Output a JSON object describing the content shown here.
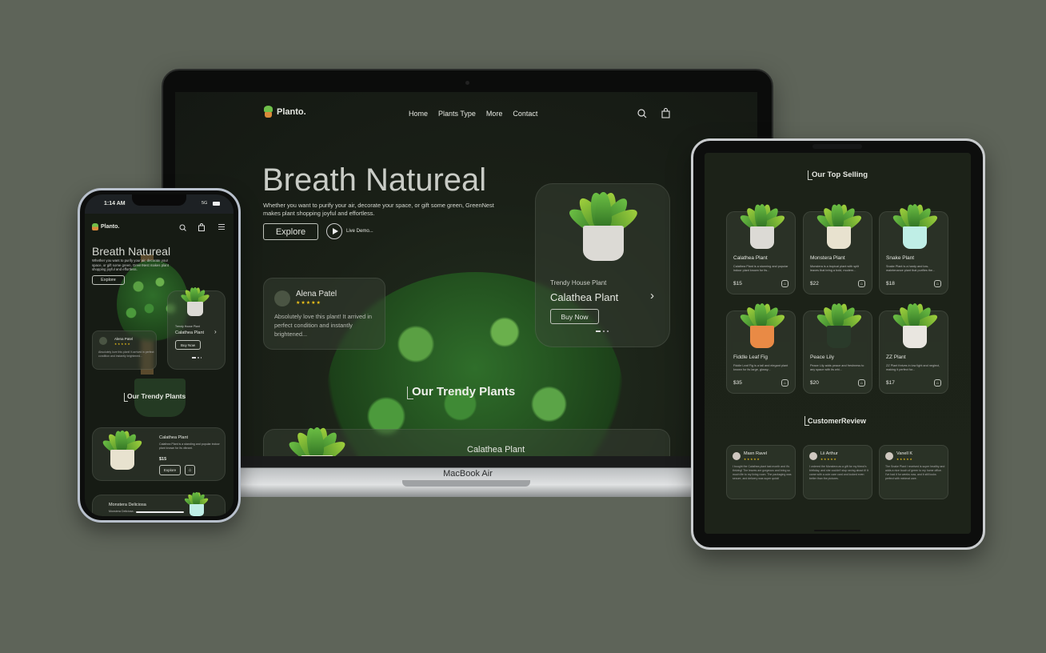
{
  "laptop": {
    "brand": "Planto.",
    "nav": [
      "Home",
      "Plants Type",
      "More",
      "Contact"
    ],
    "hero_title": "Breath Natureal",
    "hero_text": "Whether you want to purify your air, decorate your space, or gift some green, GreenNest makes plant shopping joyful and effortless.",
    "explore": "Explore",
    "live_demo": "Live Demo...",
    "review": {
      "name": "Alena Patel",
      "stars": "★★★★★",
      "text": "Absolutely love this plant! It arrived in perfect condition and instantly brightened..."
    },
    "product": {
      "subtitle": "Trendy House Plant",
      "name": "Calathea Plant",
      "button": "Buy Now",
      "chevron": "›"
    },
    "section_title": "Our Trendy Plants",
    "bottom_card_name": "Calathea Plant",
    "device_label": "MacBook Air"
  },
  "tablet": {
    "top_selling_title": "Our Top Selling",
    "products": [
      {
        "name": "Calathea Plant",
        "desc": "Calathea Plant is a stunning and popular indoor plant known for its...",
        "price": "$15"
      },
      {
        "name": "Monstera Plant",
        "desc": "Monstera is a tropical plant with split leaves that bring a bold, modern...",
        "price": "$22"
      },
      {
        "name": "Snake Plant",
        "desc": "Snake Plant is a hardy and low-maintenance plant that purifies the...",
        "price": "$18"
      },
      {
        "name": "Fiddle Leaf Fig",
        "desc": "Fiddle Leaf Fig is a tall and elegant plant known for its large, glossy...",
        "price": "$35"
      },
      {
        "name": "Peace Lily",
        "desc": "Peace Lily adds peace and freshness to any space with its whi...",
        "price": "$20"
      },
      {
        "name": "ZZ Plant",
        "desc": "ZZ Plant thrives in low light and neglect, making it perfect for...",
        "price": "$17"
      }
    ],
    "review_title": "CustomerReview",
    "reviews": [
      {
        "name": "Maxn Ravel",
        "stars": "★★★★★",
        "text": "I bought the Calathea plant last month and it's thriving! The leaves are gorgeous and bring so much life to my living room. The packaging was secure, and delivery was super quick!"
      },
      {
        "name": "Lii Arthur",
        "stars": "★★★★★",
        "text": "I ordered the Monstera as a gift for my friend's birthday, and she couldn't stop raving about it! It came with a cute care card and looked even better than the pictures."
      },
      {
        "name": "Vanell K",
        "stars": "★★★★★",
        "text": "The Snake Plant I received is super healthy and adds a nice touch of green to my home office. I've had it for weeks now, and it still looks perfect with minimal care."
      }
    ]
  },
  "phone": {
    "time": "1:14 AM",
    "network": "5G",
    "brand": "Planto.",
    "hero_title": "Breath Natureal",
    "hero_text": "Whether you want to purify your air, decorate your space, or gift some green, GreenNest makes plant shopping joyful and effortless.",
    "explore": "Explore",
    "review": {
      "name": "Alena Patel",
      "stars": "★★★★★",
      "text": "Absolutely love this plant! It arrived in perfect condition and instantly brightened..."
    },
    "product": {
      "subtitle": "Trendy House Plant",
      "name": "Calathea Plant",
      "button": "Buy Now",
      "chevron": "›"
    },
    "section_title": "Our Trendy Plants",
    "card1": {
      "name": "Calathea Plant",
      "desc": "Calathea Plant is a standing and popular indoor plant known for its vibrant.",
      "price": "$15",
      "button": "Explore"
    },
    "card2": {
      "name": "Monstera Deliciosa",
      "desc": "Monstera Deliciosa..."
    }
  },
  "colors": {
    "background": "#5e6459",
    "screen": "#1a2017",
    "star": "#f0c419"
  }
}
